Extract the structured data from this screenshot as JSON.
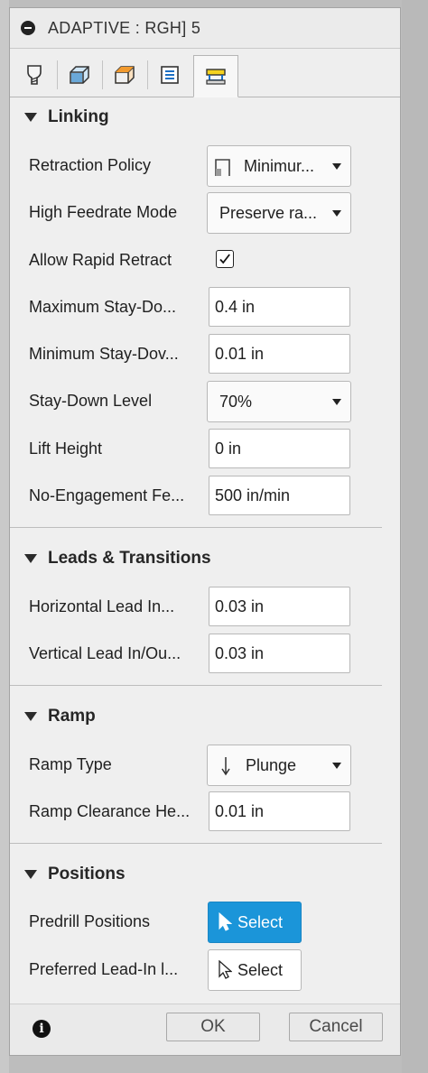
{
  "window": {
    "title": "ADAPTIVE : RGH] 5"
  },
  "tabs": [
    {
      "icon": "tool-icon"
    },
    {
      "icon": "geometry-icon"
    },
    {
      "icon": "heights-icon"
    },
    {
      "icon": "passes-icon"
    },
    {
      "icon": "linking-icon",
      "active": true
    }
  ],
  "sections": {
    "linking": {
      "title": "Linking",
      "retraction_policy": {
        "label": "Retraction Policy",
        "value": "Minimur..."
      },
      "high_feedrate_mode": {
        "label": "High Feedrate Mode",
        "value": "Preserve ra..."
      },
      "allow_rapid_retract": {
        "label": "Allow Rapid Retract",
        "checked": true
      },
      "max_stay_down": {
        "label": "Maximum Stay-Do...",
        "value": "0.4 in"
      },
      "min_stay_down": {
        "label": "Minimum Stay-Dov...",
        "value": "0.01 in"
      },
      "stay_down_level": {
        "label": "Stay-Down Level",
        "value": "70%"
      },
      "lift_height": {
        "label": "Lift Height",
        "value": "0 in"
      },
      "no_engagement_feed": {
        "label": "No-Engagement Fe...",
        "value": "500 in/min"
      }
    },
    "leads": {
      "title": "Leads & Transitions",
      "horizontal_lead": {
        "label": "Horizontal Lead In...",
        "value": "0.03 in"
      },
      "vertical_lead": {
        "label": "Vertical Lead In/Ou...",
        "value": "0.03 in"
      }
    },
    "ramp": {
      "title": "Ramp",
      "ramp_type": {
        "label": "Ramp Type",
        "value": "Plunge"
      },
      "ramp_clearance": {
        "label": "Ramp Clearance He...",
        "value": "0.01 in"
      }
    },
    "positions": {
      "title": "Positions",
      "predrill": {
        "label": "Predrill Positions",
        "button": "Select"
      },
      "preferred_lead_in": {
        "label": "Preferred Lead-In l...",
        "button": "Select"
      }
    }
  },
  "footer": {
    "ok": "OK",
    "cancel": "Cancel",
    "info_icon": "info-icon"
  },
  "colors": {
    "primary": "#1b95d9",
    "panel": "#eeeeee"
  }
}
